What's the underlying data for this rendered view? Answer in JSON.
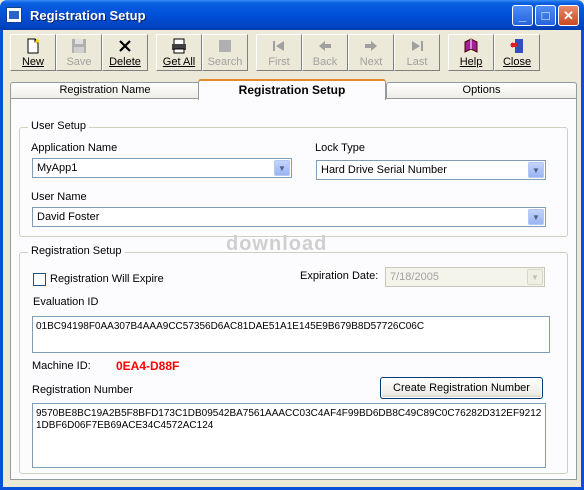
{
  "window": {
    "title": "Registration Setup",
    "controls": {
      "minimize": "_",
      "maximize": "□",
      "close": "✕"
    }
  },
  "toolbar": {
    "buttons": [
      {
        "label": "New",
        "icon": "new-document-icon",
        "enabled": true
      },
      {
        "label": "Save",
        "icon": "floppy-disk-icon",
        "enabled": false
      },
      {
        "label": "Delete",
        "icon": "x-delete-icon",
        "enabled": true
      },
      {
        "label": "Get All",
        "icon": "printer-list-icon",
        "enabled": true
      },
      {
        "label": "Search",
        "icon": "search-icon",
        "enabled": false
      },
      {
        "label": "First",
        "icon": "first-record-icon",
        "enabled": false
      },
      {
        "label": "Back",
        "icon": "back-arrow-icon",
        "enabled": false
      },
      {
        "label": "Next",
        "icon": "next-arrow-icon",
        "enabled": false
      },
      {
        "label": "Last",
        "icon": "last-record-icon",
        "enabled": false
      },
      {
        "label": "Help",
        "icon": "help-book-icon",
        "enabled": true
      },
      {
        "label": "Close",
        "icon": "exit-door-icon",
        "enabled": true
      }
    ]
  },
  "tabs": [
    {
      "label": "Registration Name",
      "active": false
    },
    {
      "label": "Registration Setup",
      "active": true
    },
    {
      "label": "Options",
      "active": false
    }
  ],
  "user_setup": {
    "title": "User Setup",
    "app_name_label": "Application Name",
    "app_name_value": "MyApp1",
    "lock_type_label": "Lock Type",
    "lock_type_value": "Hard Drive Serial Number",
    "user_name_label": "User Name",
    "user_name_value": "David Foster"
  },
  "registration_setup": {
    "title": "Registration Setup",
    "expire_label": "Registration Will Expire",
    "expire_checked": false,
    "expiration_date_label": "Expiration Date:",
    "expiration_date_value": "7/18/2005",
    "evaluation_id_label": "Evaluation ID",
    "evaluation_id_value": "01BC94198F0AA307B4AAA9CC57356D6AC81DAE51A1E145E9B679B8D57726C06C",
    "machine_id_label": "Machine ID:",
    "machine_id_value": "0EA4-D88F",
    "registration_number_label": "Registration Number",
    "create_button_label": "Create Registration Number",
    "registration_number_value": "9570BE8BC19A2B5F8BFD173C1DB09542BA7561AAACC03C4AF4F99BD6DB8C49C89C0C76282D312EF92121DBF6D06F7EB69ACE34C4572AC124"
  },
  "watermark": "download"
}
